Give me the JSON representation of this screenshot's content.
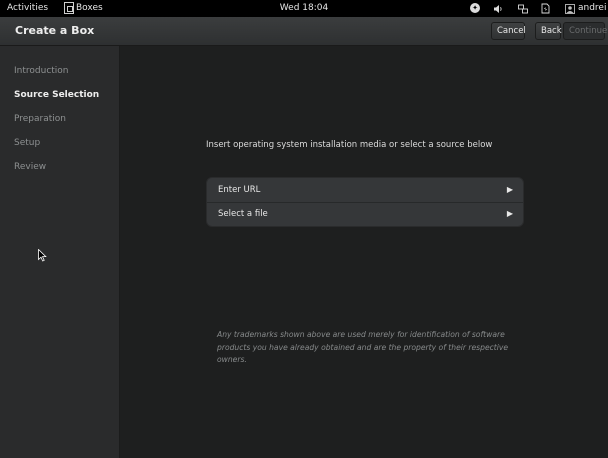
{
  "topbar": {
    "activities": "Activities",
    "app_name": "Boxes",
    "clock": "Wed 18:04",
    "user": "andrei",
    "icons": [
      "accessibility-icon",
      "volume-icon",
      "network-icon",
      "power-icon",
      "user-icon"
    ]
  },
  "header": {
    "title": "Create a Box",
    "cancel": "Cancel",
    "back": "Back",
    "continue": "Continue"
  },
  "sidebar": {
    "steps": [
      {
        "label": "Introduction",
        "active": false
      },
      {
        "label": "Source Selection",
        "active": true
      },
      {
        "label": "Preparation",
        "active": false
      },
      {
        "label": "Setup",
        "active": false
      },
      {
        "label": "Review",
        "active": false
      }
    ]
  },
  "main": {
    "instruction": "Insert operating system installation media or select a source below",
    "sources": [
      {
        "label": "Enter URL",
        "arrow": "▶"
      },
      {
        "label": "Select a file",
        "arrow": "▶"
      }
    ],
    "trademark": "Any trademarks shown above are used merely for identification of software products you have already obtained and are the property of their respective owners."
  },
  "colors": {
    "background": "#1e1f1f",
    "sidebar": "#2a2b2c",
    "header": "#35373a",
    "topbar": "#000000"
  }
}
